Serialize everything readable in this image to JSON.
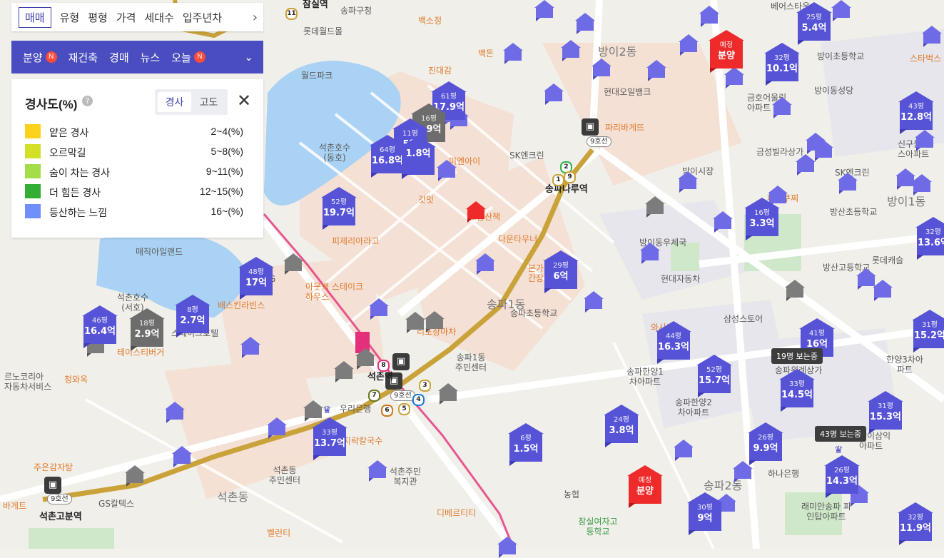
{
  "filters": {
    "tabs": [
      "매매",
      "유형",
      "평형",
      "가격",
      "세대수",
      "입주년차"
    ],
    "active_tab": "매매",
    "more_icon": "chevron-right-icon"
  },
  "layers": {
    "items": [
      {
        "label": "분양",
        "badge": "N"
      },
      {
        "label": "재건축",
        "badge": ""
      },
      {
        "label": "경매",
        "badge": ""
      },
      {
        "label": "뉴스",
        "badge": ""
      },
      {
        "label": "오늘",
        "badge": "N"
      }
    ],
    "expand_icon": "chevron-down-icon"
  },
  "legend": {
    "title": "경사도(%)",
    "help_icon": "question-icon",
    "toggle": [
      "경사",
      "고도"
    ],
    "active_toggle": "경사",
    "close_icon": "close-icon",
    "rows": [
      {
        "name": "얕은 경사",
        "range": "2~4(%)",
        "color": "#fdd21c"
      },
      {
        "name": "오르막길",
        "range": "5~8(%)",
        "color": "#d4e026"
      },
      {
        "name": "숨이 차는 경사",
        "range": "9~11(%)",
        "color": "#a3de4a"
      },
      {
        "name": "더 힘든 경사",
        "range": "12~15(%)",
        "color": "#34ad34"
      },
      {
        "name": "등산하는 느낌",
        "range": "16~(%)",
        "color": "#6f8ffb"
      }
    ]
  },
  "listings": [
    {
      "size": "61평",
      "price": "17.9억",
      "style": "blue"
    },
    {
      "size": "16평",
      "price": "2.9억",
      "style": "gray"
    },
    {
      "size": "11평",
      "price": "5억",
      "style": "blue"
    },
    {
      "size": "64평",
      "price": "16.8억",
      "style": "blue"
    },
    {
      "size": "",
      "price": "1.8억",
      "style": "blue"
    },
    {
      "size": "52평",
      "price": "19.7억",
      "style": "blue"
    },
    {
      "size": "48평",
      "price": "17억",
      "style": "blue"
    },
    {
      "size": "46평",
      "price": "16.4억",
      "style": "blue"
    },
    {
      "size": "18평",
      "price": "2.9억",
      "style": "gray"
    },
    {
      "size": "8평",
      "price": "2.7억",
      "style": "blue"
    },
    {
      "size": "33평",
      "price": "13.7억",
      "style": "blue"
    },
    {
      "size": "6평",
      "price": "1.5억",
      "style": "blue"
    },
    {
      "size": "24평",
      "price": "3.8억",
      "style": "blue"
    },
    {
      "size": "29평",
      "price": "6억",
      "style": "blue"
    },
    {
      "size": "44평",
      "price": "16.3억",
      "style": "blue"
    },
    {
      "size": "52평",
      "price": "15.7억",
      "style": "blue"
    },
    {
      "size": "30평",
      "price": "9억",
      "style": "blue"
    },
    {
      "size": "33평",
      "price": "14.5억",
      "style": "blue"
    },
    {
      "size": "26평",
      "price": "9.9억",
      "style": "blue"
    },
    {
      "size": "26평",
      "price": "14.3억",
      "style": "blue"
    },
    {
      "size": "41평",
      "price": "16억",
      "style": "blue"
    },
    {
      "size": "31평",
      "price": "15.3억",
      "style": "blue"
    },
    {
      "size": "31평",
      "price": "15.2억",
      "style": "blue"
    },
    {
      "size": "32평",
      "price": "11.9억",
      "style": "blue"
    },
    {
      "size": "16평",
      "price": "3.3억",
      "style": "blue"
    },
    {
      "size": "32평",
      "price": "10.1억",
      "style": "blue"
    },
    {
      "size": "25평",
      "price": "5.4억",
      "style": "blue"
    },
    {
      "size": "43평",
      "price": "12.8억",
      "style": "blue"
    },
    {
      "size": "32평",
      "price": "13.6억",
      "style": "blue"
    },
    {
      "size": "예정",
      "price": "분양",
      "style": "red"
    },
    {
      "size": "예정",
      "price": "분양",
      "style": "red"
    }
  ],
  "viewers": [
    "19명 보는중",
    "43명 보는중"
  ],
  "stations": [
    {
      "name": "송파나루역",
      "line": "9호선"
    },
    {
      "name": "석촌역",
      "line": "9호선"
    },
    {
      "name": "석촌고분역",
      "line": "9호선"
    }
  ],
  "line_numbers": [
    "8",
    "11",
    "2",
    "9",
    "1",
    "7",
    "6",
    "5",
    "4",
    "3"
  ],
  "places": {
    "areas": [
      "방이2동",
      "송파1동",
      "송파2동",
      "방이1동",
      "석촌동"
    ],
    "pois_orange": [
      "백소정",
      "백돈",
      "진대감",
      "파리바게뜨",
      "미엔아이",
      "갓잇",
      "피제리아라고",
      "아웃백 스테이크하우스",
      "배스킨라빈스",
      "다운타우너",
      "본가 진미간장게장",
      "리포장마차",
      "황도 바지락칼국수",
      "디베르티티",
      "주은감자탕",
      "청와옥",
      "테이스티버거",
      "바게트",
      "스타벅스",
      "파스쿠찌",
      "벨런티",
      "와사비",
      "고봉산책"
    ],
    "pois_blue": [
      "송파구청",
      "월드파크",
      "석촌호수(동호)",
      "석촌호수(서호)",
      "SK엔크린",
      "현대오일뱅크",
      "금호어울림아파트",
      "방이동성당",
      "방이초등학교",
      "금성빌라상가",
      "방이시장",
      "SK엔크린",
      "방산초등학교",
      "방이동우체국",
      "현대자동차",
      "방산고등학교",
      "송파초등학교",
      "삼성스토어",
      "송파한양1차아파트",
      "송파한양2차아파트",
      "송파위례상가",
      "하나은행",
      "래미안송파 파인탑아파트",
      "잠실여자고등학교",
      "농협",
      "석촌동 주민센터",
      "석촌주민 복지관",
      "우리은행",
      "매직아일랜드",
      "스페이크호텔",
      "르노코리아 자동차서비스",
      "LPG",
      "GS칼텍스",
      "한양3차아파트",
      "신구블레스아파트",
      "방이삼익아파트",
      "송파1동 주민센터",
      "롯데월드몰",
      "잠실역",
      "베어스타운",
      "롯데캐슬"
    ],
    "pois_green": [
      "잠실여자고등학교"
    ]
  }
}
